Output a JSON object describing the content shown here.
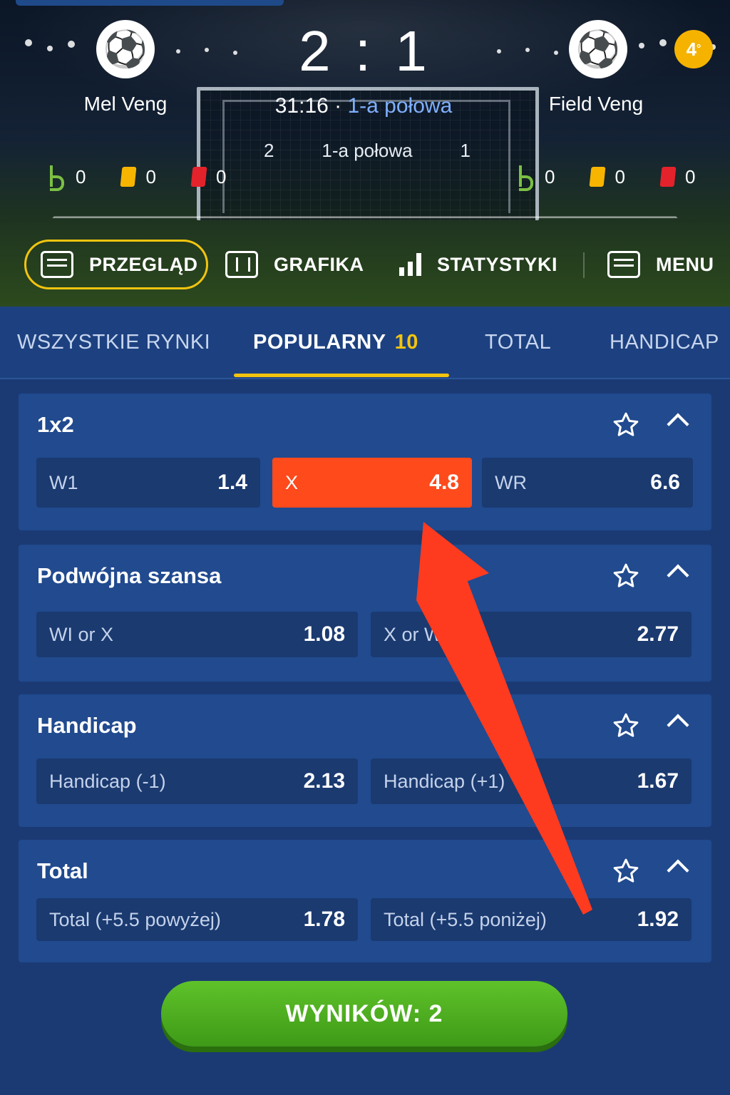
{
  "match": {
    "home_team": "Mel Veng",
    "away_team": "Field Veng",
    "score_home": "2",
    "score_sep": ":",
    "score_away": "1",
    "clock": "31:16",
    "clock_sep": " · ",
    "phase": "1-a połowa",
    "half_home": "2",
    "half_label": "1-a połowa",
    "half_away": "1",
    "live_badge": "4",
    "home_stats": {
      "corners": "0",
      "yellow": "0",
      "red": "0"
    },
    "away_stats": {
      "corners": "0",
      "yellow": "0",
      "red": "0"
    }
  },
  "nav": {
    "overview": "PRZEGLĄD",
    "graphics": "GRAFIKA",
    "stats": "STATYSTYKI",
    "menu": "MENU"
  },
  "tabs": {
    "all": "WSZYSTKIE RYNKI",
    "popular": "POPULARNY",
    "popular_count": "10",
    "total": "TOTAL",
    "handicap": "HANDICAP"
  },
  "markets": [
    {
      "title": "1x2",
      "odds": [
        {
          "label": "W1",
          "value": "1.4"
        },
        {
          "label": "X",
          "value": "4.8",
          "selected": true
        },
        {
          "label": "WR",
          "value": "6.6"
        }
      ]
    },
    {
      "title": "Podwójna szansa",
      "odds": [
        {
          "label": "WI or X",
          "value": "1.08"
        },
        {
          "label": "X or WR",
          "value": "2.77"
        }
      ]
    },
    {
      "title": "Handicap",
      "odds": [
        {
          "label": "Handicap (-1)",
          "value": "2.13"
        },
        {
          "label": "Handicap (+1)",
          "value": "1.67"
        }
      ]
    },
    {
      "title": "Total",
      "odds": [
        {
          "label": "Total (+5.5 powyżej)",
          "value": "1.78"
        },
        {
          "label": "Total (+5.5 poniżej)",
          "value": "1.92"
        }
      ]
    }
  ],
  "results_button": "WYNIKÓW: 2",
  "colors": {
    "accent": "#f2c40f",
    "selected": "#ff4a1c",
    "arrow": "#ff3b1f",
    "button": "#4caf22"
  }
}
